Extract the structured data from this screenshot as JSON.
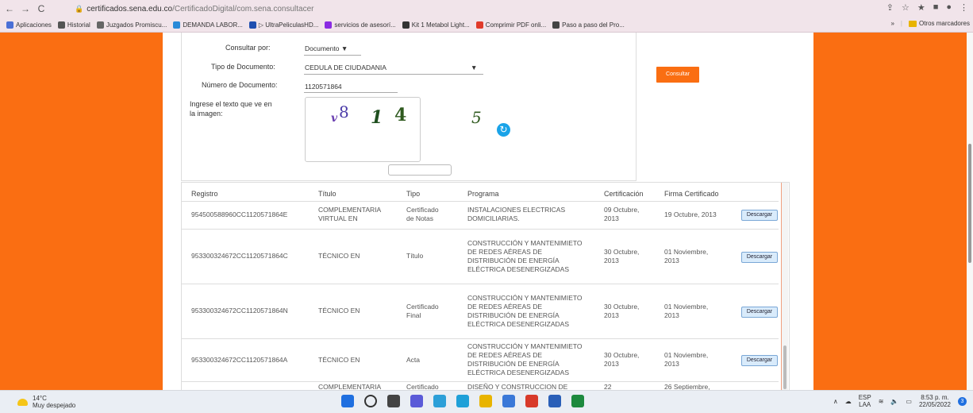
{
  "browser": {
    "url_domain": "certificados.sena.edu.co",
    "url_path": "/CertificadoDigital/com.sena.consultacer",
    "bookmarks": [
      {
        "label": "Aplicaciones",
        "color": "#4a6fd6"
      },
      {
        "label": "Historial",
        "color": "#555555"
      },
      {
        "label": "Juzgados Promiscu...",
        "color": "#666666"
      },
      {
        "label": "DEMANDA LABOR...",
        "color": "#2a8ad8"
      },
      {
        "label": "▷ UltraPeliculasHD...",
        "color": "#1f4fb0"
      },
      {
        "label": "servicios de asesorí...",
        "color": "#8a2be2"
      },
      {
        "label": "Kit 1 Metabol Light...",
        "color": "#333333"
      },
      {
        "label": "Comprimir PDF onli...",
        "color": "#e03a2a"
      },
      {
        "label": "Paso a paso del Pro...",
        "color": "#444444"
      }
    ],
    "overflow_label": "»",
    "other_bookmarks": "Otros marcadores"
  },
  "form": {
    "consultar_por_label": "Consultar por:",
    "consultar_por_value": "Documento ▼",
    "tipo_doc_label": "Tipo de Documento:",
    "tipo_doc_value": "CEDULA DE CIUDADANIA",
    "tipo_doc_arrow": "▼",
    "numero_doc_label": "Número de Documento:",
    "numero_doc_value": "1120571864",
    "captcha_label_1": "Ingrese el texto que ve en",
    "captcha_label_2": "la imagen:",
    "captcha_chars": [
      "v",
      "8",
      "1",
      "4",
      "5"
    ],
    "consultar_button": "Consultar"
  },
  "table": {
    "headers": [
      "Registro",
      "Título",
      "Tipo",
      "Programa",
      "Certificación",
      "Firma Certificado"
    ],
    "download_label": "Descargar",
    "rows": [
      {
        "registro": "954500588960CC1120571864E",
        "titulo": [
          "COMPLEMENTARIA",
          "VIRTUAL EN"
        ],
        "tipo": [
          "Certificado",
          "de Notas"
        ],
        "programa": [
          "INSTALACIONES ELECTRICAS",
          "DOMICILIARIAS."
        ],
        "certificacion": [
          "09 Octubre,",
          "2013"
        ],
        "firma": [
          "19 Octubre, 2013"
        ]
      },
      {
        "registro": "953300324672CC1120571864C",
        "titulo": [
          "TÉCNICO EN"
        ],
        "tipo": [
          "Título"
        ],
        "programa": [
          "CONSTRUCCIÓN Y MANTENIMIETO",
          "DE REDES AÉREAS DE",
          "DISTRIBUCIÓN DE ENERGÍA",
          "ELÉCTRICA DESENERGIZADAS"
        ],
        "certificacion": [
          "30 Octubre,",
          "2013"
        ],
        "firma": [
          "01 Noviembre,",
          "2013"
        ]
      },
      {
        "registro": "953300324672CC1120571864N",
        "titulo": [
          "TÉCNICO EN"
        ],
        "tipo": [
          "Certificado",
          "Final"
        ],
        "programa": [
          "CONSTRUCCIÓN Y MANTENIMIETO",
          "DE REDES AÉREAS DE",
          "DISTRIBUCIÓN DE ENERGÍA",
          "ELÉCTRICA DESENERGIZADAS"
        ],
        "certificacion": [
          "30 Octubre,",
          "2013"
        ],
        "firma": [
          "01 Noviembre,",
          "2013"
        ]
      },
      {
        "registro": "953300324672CC1120571864A",
        "titulo": [
          "TÉCNICO EN"
        ],
        "tipo": [
          "Acta"
        ],
        "programa": [
          "CONSTRUCCIÓN Y MANTENIMIETO",
          "DE REDES AÉREAS DE",
          "DISTRIBUCIÓN DE ENERGÍA",
          "ELÉCTRICA DESENERGIZADAS"
        ],
        "certificacion": [
          "30 Octubre,",
          "2013"
        ],
        "firma": [
          "01 Noviembre,",
          "2013"
        ]
      },
      {
        "registro": "",
        "titulo": [
          "COMPLEMENTARIA"
        ],
        "tipo": [
          "Certificado"
        ],
        "programa": [
          "DISEÑO Y CONSTRUCCION DE"
        ],
        "certificacion": [
          "22"
        ],
        "firma": [
          "26 Septiembre,"
        ]
      }
    ]
  },
  "taskbar": {
    "temperature": "14°C",
    "weather": "Muy despejado",
    "lang_1": "ESP",
    "lang_2": "LAA",
    "time": "8:53 p. m.",
    "date": "22/05/2022",
    "notifications": "3",
    "app_colors": [
      "#1f6fe0",
      "#333333",
      "#444444",
      "#5a5ad8",
      "#2c9fd8",
      "#1fa0d8",
      "#e8b400",
      "#3a78d8",
      "#d83a2a",
      "#2a5fb8",
      "#1d8a3e"
    ]
  }
}
